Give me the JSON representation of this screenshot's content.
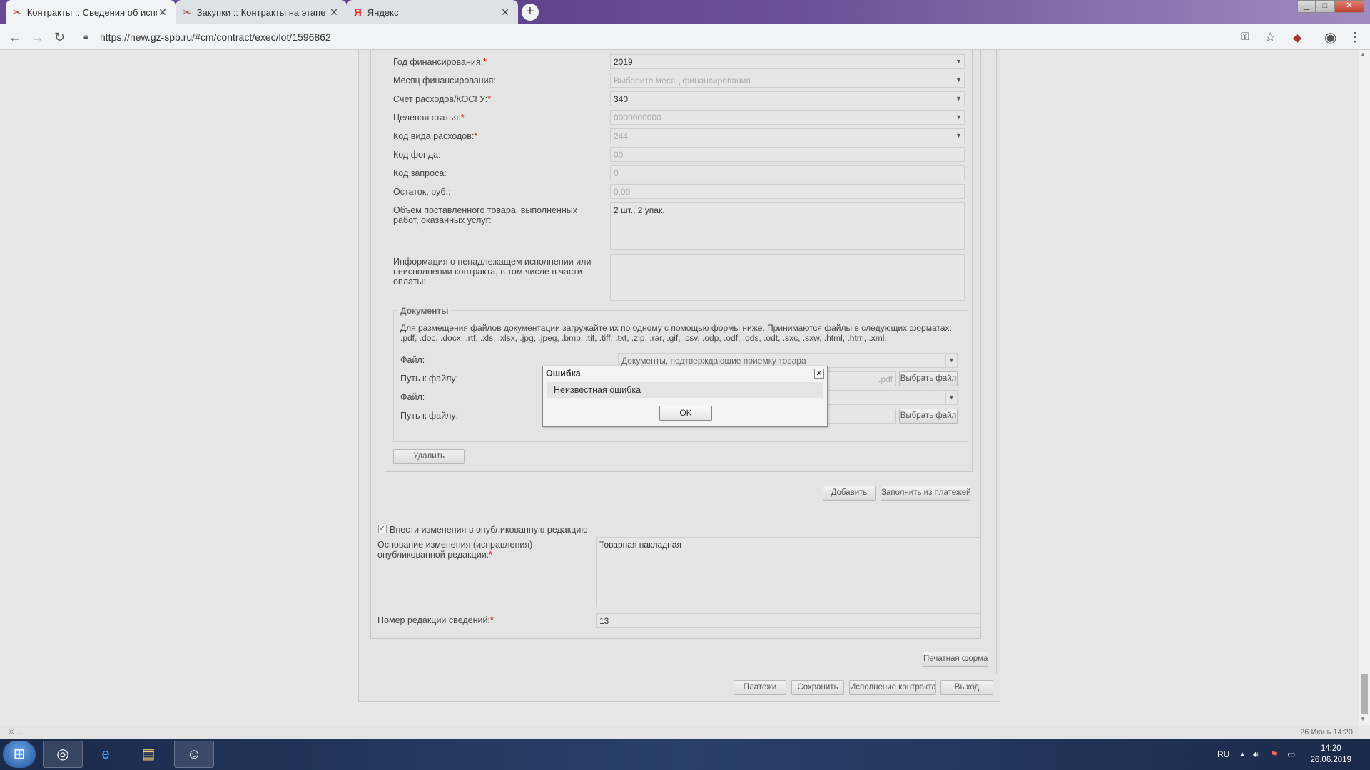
{
  "browser": {
    "tabs": [
      {
        "title": "Контракты :: Сведения об испо",
        "active": true
      },
      {
        "title": "Закупки :: Контракты на этапе и",
        "active": false
      },
      {
        "title": "Яндекс",
        "active": false
      }
    ],
    "url": "https://new.gz-spb.ru/#cm/contract/exec/lot/1596862"
  },
  "form": {
    "fin_year_label": "Год финансирования:",
    "fin_year_value": "2019",
    "fin_month_label": "Месяц финансирования:",
    "fin_month_placeholder": "Выберите месяц финансирования",
    "kosgu_label": "Счет расходов/КОСГУ:",
    "kosgu_value": "340",
    "target_label": "Целевая статья:",
    "target_value": "0000000000",
    "exp_type_label": "Код вида расходов:",
    "exp_type_value": "244",
    "fund_label": "Код фонда:",
    "fund_value": "00",
    "request_label": "Код запроса:",
    "request_value": "0",
    "balance_label": "Остаток, руб.:",
    "balance_value": "0,00",
    "volume_label": "Объем поставленного товара, выполненных работ, оказанных услуг:",
    "volume_value": "2 шт., 2 упак.",
    "improper_label": "Информация о ненадлежащем исполнении или неисполнении контракта, в том числе в части оплаты:",
    "improper_value": ""
  },
  "documents": {
    "legend": "Документы",
    "hint": "Для размещения файлов документации загружайте их по одному с помощью формы ниже. Принимаются файлы в следующих форматах: .pdf, .doc, .docx, .rtf, .xls, .xlsx, .jpg, .jpeg, .bmp, .tif, .tiff, .txt, .zip, .rar, .gif, .csv, .odp, .odf, .ods, .odt, .sxc, .sxw, .html, .htm, .xml.",
    "file_label": "Файл:",
    "file1_value": "Документы, подтверждающие приемку товара",
    "path_label": "Путь к файлу:",
    "path1_value": ".pdf",
    "choose_file": "Выбрать файл",
    "delete": "Удалить"
  },
  "actions": {
    "add": "Добавить",
    "fill_from_payments": "Заполнить из платежей"
  },
  "changes": {
    "checkbox_label": "Внести изменения в опубликованную редакцию",
    "reason_label": "Основание изменения (исправления) опубликованной редакции:",
    "reason_value": "Товарная накладная",
    "revision_label": "Номер редакции сведений:",
    "revision_value": "13"
  },
  "footer_buttons": {
    "print": "Печатная форма",
    "payments": "Платежи",
    "save": "Сохранить",
    "execution": "Исполнение контракта",
    "exit": "Выход"
  },
  "status": {
    "left": "© ...",
    "right": "26 Июнь 14:20"
  },
  "dialog": {
    "title": "Ошибка",
    "message": "Неизвестная ошибка",
    "ok": "OK"
  },
  "taskbar": {
    "lang": "RU",
    "time": "14:20",
    "date": "26.06.2019"
  },
  "colors": {
    "required": "#d40000",
    "titlebar": "#6a4a92"
  }
}
